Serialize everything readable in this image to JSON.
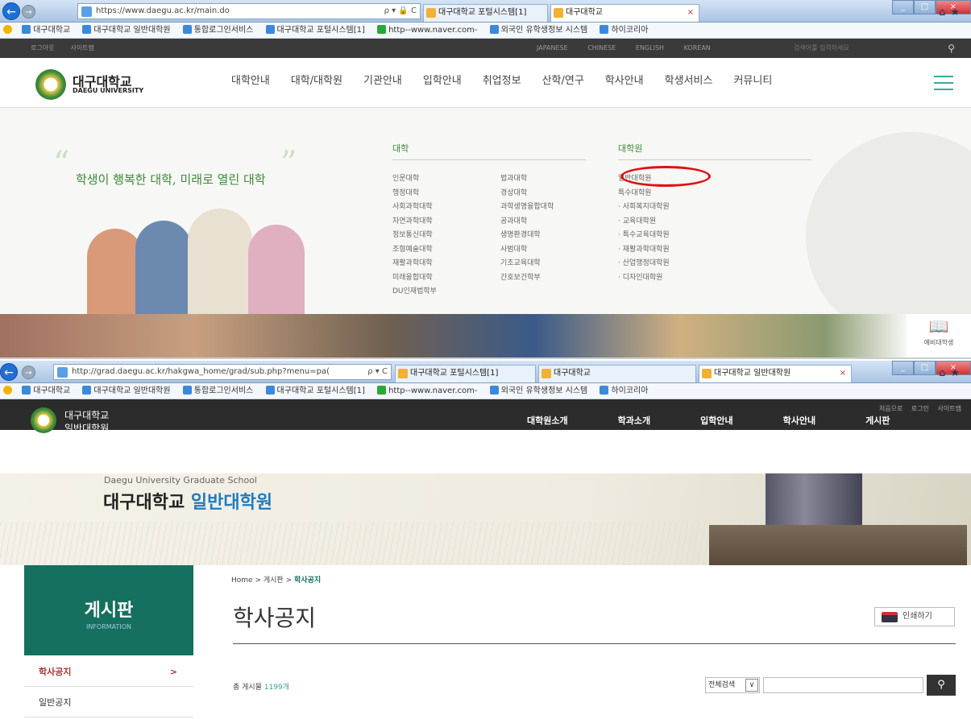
{
  "window1": {
    "address": "https://www.daegu.ac.kr/main.do",
    "address_controls": "ρ ▾ 🔒 C",
    "tabs": [
      "대구대학교 포털시스템[1]",
      "대구대학교"
    ],
    "favorites": [
      "대구대학교",
      "대구대학교 일반대학원",
      "통합로그인서비스",
      "대구대학교 포털시스템[1]",
      "http--www.naver.com-",
      "외국인 유학생정보 시스템",
      "하이코리아"
    ],
    "util_left": [
      "로그아웃",
      "사이트맵"
    ],
    "languages": [
      "JAPANESE",
      "CHINESE",
      "ENGLISH",
      "KOREAN"
    ],
    "search_placeholder": "검색어를 입력하세요",
    "logo_ko": "대구대학교",
    "logo_en": "DAEGU UNIVERSITY",
    "menu": [
      "대학안내",
      "대학/대학원",
      "기관안내",
      "입학안내",
      "취업정보",
      "산학/연구",
      "학사안내",
      "학생서비스",
      "커뮤니티"
    ],
    "slogan": "학생이 행복한 대학, 미래로 열린 대학",
    "college_heading": "대학",
    "graduate_heading": "대학원",
    "colleges_a": [
      "인문대학",
      "행정대학",
      "사회과학대학",
      "자연과학대학",
      "정보통신대학",
      "조형예술대학",
      "재활과학대학",
      "미래융합대학",
      "DU인재법학부"
    ],
    "colleges_b": [
      "법과대학",
      "경상대학",
      "과학생명융합대학",
      "공과대학",
      "생명환경대학",
      "사범대학",
      "기초교육대학",
      "간호보건학부"
    ],
    "graduate_schools": [
      "일반대학원",
      "특수대학원",
      "· 사회복지대학원",
      "· 교육대학원",
      "· 특수교육대학원",
      "· 재활과학대학원",
      "· 산업행정대학원",
      "· 디자인대학원"
    ],
    "prep_label": "예비대학생"
  },
  "window2": {
    "address": "http://grad.daegu.ac.kr/hakgwa_home/grad/sub.php?menu=pa(",
    "address_controls": "ρ ▾ C",
    "tabs": [
      "대구대학교 포털시스템[1]",
      "대구대학교",
      "대구대학교 일반대학원"
    ],
    "favorites": [
      "대구대학교",
      "대구대학교 일반대학원",
      "통합로그인서비스",
      "대구대학교 포털시스템[1]",
      "http--www.naver.com-",
      "외국인 유학생정보 시스템",
      "하이코리아"
    ],
    "util": [
      "처음으로",
      "로그인",
      "사이트맵"
    ],
    "school_name_1": "대구대학교",
    "school_name_2": "일반대학원",
    "menu": [
      "대학원소개",
      "학과소개",
      "입학안내",
      "학사안내",
      "게시판"
    ],
    "hero_en": "Daegu University Graduate School",
    "hero_ko_1": "대구대학교",
    "hero_ko_2": "일반대학원",
    "side_title": "게시판",
    "side_sub": "INFORMATION",
    "side_nav": [
      "학사공지",
      "일반공지"
    ],
    "side_arrow": ">",
    "crumb_home": "Home",
    "crumb_sep": ">",
    "crumb_mid": "게시판",
    "crumb_current": "학사공지",
    "page_title": "학사공지",
    "print_label": "인쇄하기",
    "total_label": "총 게시물",
    "total_count": "1199개",
    "scope_label": "전체검색",
    "scope_caret": "∨",
    "search_icon": "search-icon"
  }
}
